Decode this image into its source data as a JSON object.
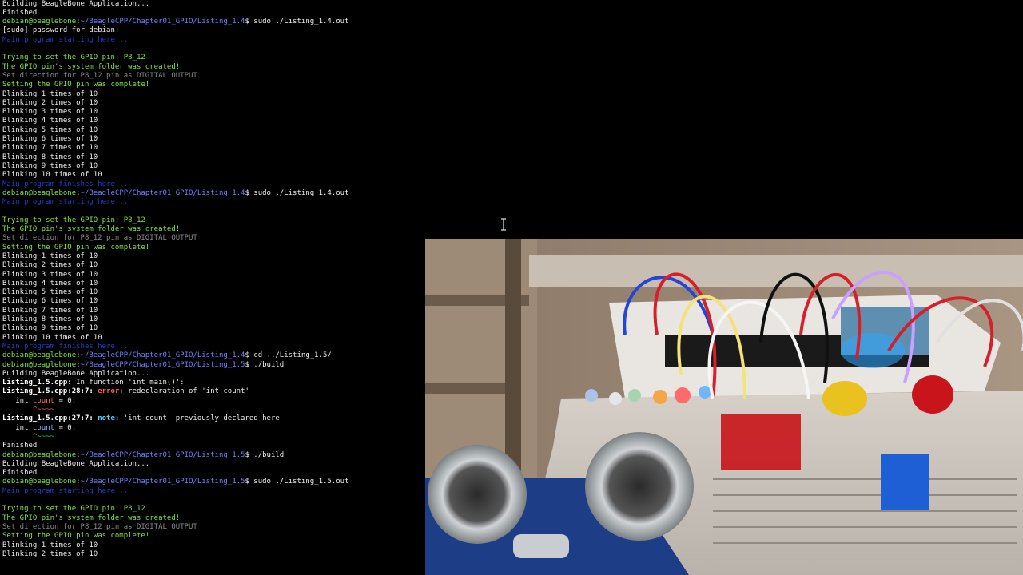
{
  "terminal": {
    "lines": [
      {
        "cls": "w",
        "text": "Building BeagleBone Application..."
      },
      {
        "cls": "w",
        "text": "Finished"
      },
      {
        "type": "prompt",
        "cwd": "~/BeagleCPP/Chapter01_GPIO/Listing_1.4",
        "cmd": " sudo ./Listing_1.4.out"
      },
      {
        "cls": "w",
        "text": "[sudo] password for debian:"
      },
      {
        "cls": "b",
        "text": "Main program starting here..."
      },
      {
        "cls": "w",
        "text": ""
      },
      {
        "cls": "g",
        "text": "Trying to set the GPIO pin: P8_12"
      },
      {
        "cls": "g",
        "text": "The GPIO pin's system folder was created!"
      },
      {
        "cls": "dim",
        "text": "Set direction for P8_12 pin as DIGITAL OUTPUT"
      },
      {
        "cls": "g",
        "text": "Setting the GPIO pin was complete!"
      },
      {
        "cls": "w",
        "text": "Blinking 1 times of 10"
      },
      {
        "cls": "w",
        "text": "Blinking 2 times of 10"
      },
      {
        "cls": "w",
        "text": "Blinking 3 times of 10"
      },
      {
        "cls": "w",
        "text": "Blinking 4 times of 10"
      },
      {
        "cls": "w",
        "text": "Blinking 5 times of 10"
      },
      {
        "cls": "w",
        "text": "Blinking 6 times of 10"
      },
      {
        "cls": "w",
        "text": "Blinking 7 times of 10"
      },
      {
        "cls": "w",
        "text": "Blinking 8 times of 10"
      },
      {
        "cls": "w",
        "text": "Blinking 9 times of 10"
      },
      {
        "cls": "w",
        "text": "Blinking 10 times of 10"
      },
      {
        "cls": "b",
        "text": "Main program finishes here..."
      },
      {
        "type": "prompt",
        "cwd": "~/BeagleCPP/Chapter01_GPIO/Listing_1.4",
        "cmd": " sudo ./Listing_1.4.out"
      },
      {
        "cls": "b",
        "text": "Main program starting here..."
      },
      {
        "cls": "w",
        "text": ""
      },
      {
        "cls": "g",
        "text": "Trying to set the GPIO pin: P8_12"
      },
      {
        "cls": "g",
        "text": "The GPIO pin's system folder was created!"
      },
      {
        "cls": "dim",
        "text": "Set direction for P8_12 pin as DIGITAL OUTPUT"
      },
      {
        "cls": "g",
        "text": "Setting the GPIO pin was complete!"
      },
      {
        "cls": "w",
        "text": "Blinking 1 times of 10"
      },
      {
        "cls": "w",
        "text": "Blinking 2 times of 10"
      },
      {
        "cls": "w",
        "text": "Blinking 3 times of 10"
      },
      {
        "cls": "w",
        "text": "Blinking 4 times of 10"
      },
      {
        "cls": "w",
        "text": "Blinking 5 times of 10"
      },
      {
        "cls": "w",
        "text": "Blinking 6 times of 10"
      },
      {
        "cls": "w",
        "text": "Blinking 7 times of 10"
      },
      {
        "cls": "w",
        "text": "Blinking 8 times of 10"
      },
      {
        "cls": "w",
        "text": "Blinking 9 times of 10"
      },
      {
        "cls": "w",
        "text": "Blinking 10 times of 10"
      },
      {
        "cls": "b",
        "text": "Main program finishes here..."
      },
      {
        "type": "prompt",
        "cwd": "~/BeagleCPP/Chapter01_GPIO/Listing_1.4",
        "cmd": " cd ../Listing_1.5/"
      },
      {
        "type": "prompt",
        "cwd": "~/BeagleCPP/Chapter01_GPIO/Listing_1.5",
        "cmd": " ./build"
      },
      {
        "cls": "w",
        "text": "Building BeagleBone Application..."
      },
      {
        "type": "diag",
        "file": "Listing_1.5.cpp:",
        "kind": "",
        "msg": " In function 'int main()':"
      },
      {
        "type": "diag",
        "file": "Listing_1.5.cpp:28:7:",
        "kind": " error:",
        "msg": " redeclaration of 'int count'"
      },
      {
        "type": "code",
        "pre": "   int ",
        "hl": "count",
        "post": " = 0;",
        "hlcls": "hl-r"
      },
      {
        "type": "squig",
        "pad": "       ",
        "text": "^~~~~",
        "cls": "sq-r"
      },
      {
        "type": "diag",
        "file": "Listing_1.5.cpp:27:7:",
        "kind": " note:",
        "msg": " 'int count' previously declared here"
      },
      {
        "type": "code",
        "pre": "   int ",
        "hl": "count",
        "post": " = 0;",
        "hlcls": "hl-b"
      },
      {
        "type": "squig",
        "pad": "       ",
        "text": "^~~~~",
        "cls": "sq-g"
      },
      {
        "cls": "w",
        "text": "Finished"
      },
      {
        "type": "prompt",
        "cwd": "~/BeagleCPP/Chapter01_GPIO/Listing_1.5",
        "cmd": " ./build"
      },
      {
        "cls": "w",
        "text": "Building BeagleBone Application..."
      },
      {
        "cls": "w",
        "text": "Finished"
      },
      {
        "type": "prompt",
        "cwd": "~/BeagleCPP/Chapter01_GPIO/Listing_1.5",
        "cmd": " sudo ./Listing_1.5.out"
      },
      {
        "cls": "b",
        "text": "Main program starting here..."
      },
      {
        "cls": "w",
        "text": ""
      },
      {
        "cls": "g",
        "text": "Trying to set the GPIO pin: P8_12"
      },
      {
        "cls": "g",
        "text": "The GPIO pin's system folder was created!"
      },
      {
        "cls": "dim",
        "text": "Set direction for P8_12 pin as DIGITAL OUTPUT"
      },
      {
        "cls": "g",
        "text": "Setting the GPIO pin was complete!"
      },
      {
        "cls": "w",
        "text": "Blinking 1 times of 10"
      },
      {
        "cls": "w",
        "text": "Blinking 2 times of 10"
      }
    ],
    "prompt_user": "debian@beaglebone",
    "prompt_sep": ":",
    "prompt_end": "$"
  },
  "webcam": {
    "description_icon": "breadboard-camera-feed"
  },
  "colors": {
    "green": "#7ee63a",
    "blue": "#1f3ad0",
    "path": "#6f7fff",
    "error": "#ff5a5a",
    "note": "#5ad0ff"
  }
}
